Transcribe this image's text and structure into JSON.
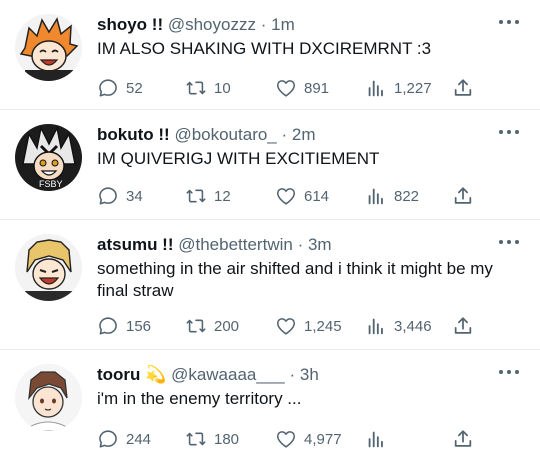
{
  "tweets": [
    {
      "name": "shoyo !!",
      "handle": "@shoyozzz",
      "separator": "·",
      "time": "1m",
      "text": "IM ALSO SHAKING WITH DXCIREMRNT :3",
      "replies": "52",
      "retweets": "10",
      "likes": "891",
      "views": "1,227"
    },
    {
      "name": "bokuto !!",
      "handle": "@bokoutaro_",
      "separator": "·",
      "time": "2m",
      "text": "IM QUIVERIGJ WITH EXCITIEMENT",
      "replies": "34",
      "retweets": "12",
      "likes": "614",
      "views": "822"
    },
    {
      "name": "atsumu !!",
      "handle": "@thebettertwin",
      "separator": "·",
      "time": "3m",
      "text": "something in the air shifted and i think it might be my final straw",
      "replies": "156",
      "retweets": "200",
      "likes": "1,245",
      "views": "3,446"
    },
    {
      "name": "tooru 💫",
      "handle": "@kawaaaa___",
      "separator": "·",
      "time": "3h",
      "text": "i'm in the enemy territory ...",
      "replies": "244",
      "retweets": "180",
      "likes": "4,977",
      "views": ""
    }
  ],
  "colors": {
    "text": "#0f1419",
    "muted": "#536471",
    "divider": "#e6ecf0"
  },
  "icons": [
    "reply-icon",
    "retweet-icon",
    "like-icon",
    "views-icon",
    "share-icon",
    "more-icon"
  ]
}
